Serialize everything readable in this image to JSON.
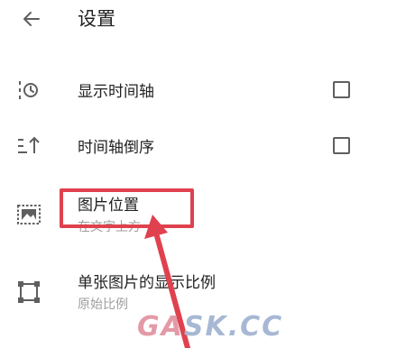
{
  "header": {
    "title": "设置"
  },
  "settings": [
    {
      "title": "显示时间轴",
      "icon": "timeline-clock-icon",
      "checked": false
    },
    {
      "title": "时间轴倒序",
      "icon": "reverse-order-icon",
      "checked": false
    },
    {
      "title": "图片位置",
      "subtitle": "在文字上方",
      "icon": "image-position-icon"
    },
    {
      "title": "单张图片的显示比例",
      "subtitle": "原始比例",
      "icon": "aspect-ratio-icon"
    }
  ],
  "watermark": {
    "part1": "GA",
    "part2": "SK.CC"
  },
  "colors": {
    "highlight": "#e0414e",
    "text": "#212121",
    "secondary_text": "#9e9e9e"
  }
}
